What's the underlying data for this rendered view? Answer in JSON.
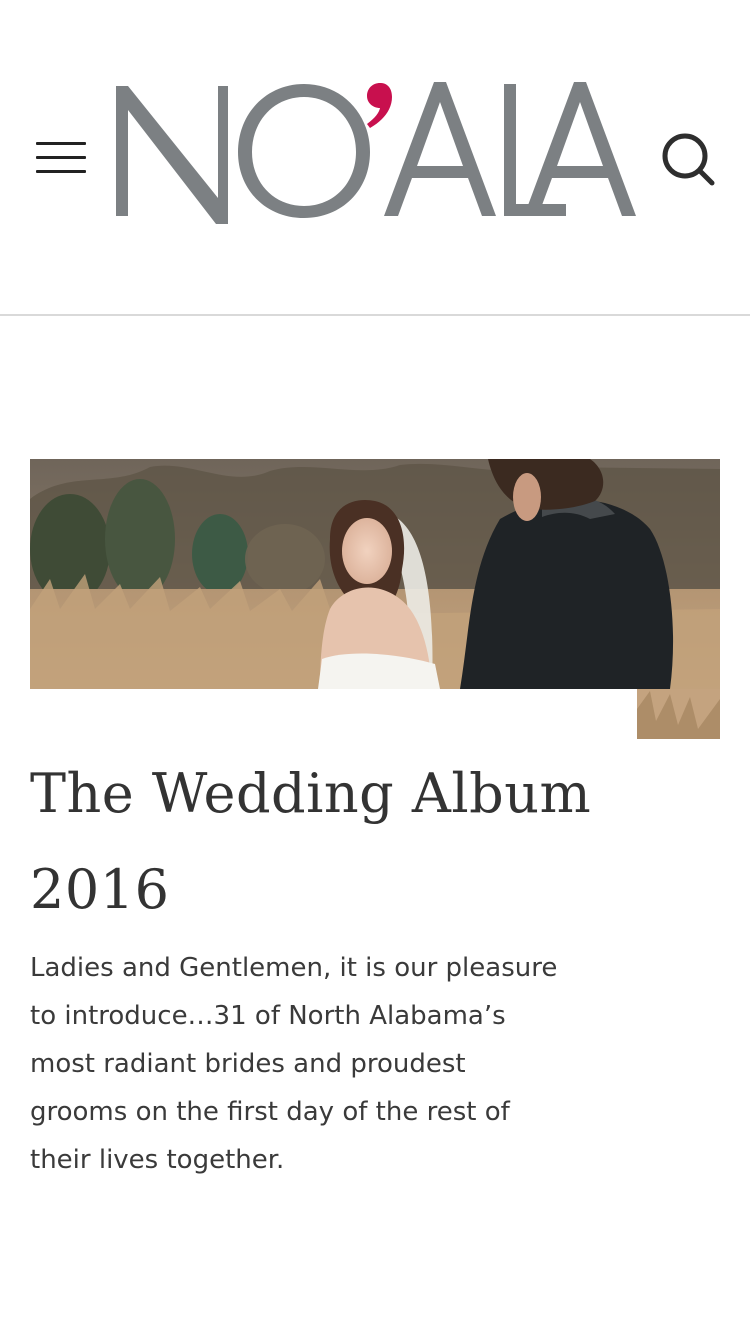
{
  "header": {
    "menu_icon": "hamburger-menu-icon",
    "logo_text": "NO'ALA",
    "logo_colors": {
      "text": "#7c8083",
      "apostrophe": "#c8104e"
    },
    "search_icon": "search-icon"
  },
  "article": {
    "image_alt": "Bride in white gown smiling over her shoulder at groom in a dark tuxedo in a meadow",
    "title": "The Wedding Album 2016",
    "description": "Ladies and Gentlemen, it is our pleasure to introduce…31 of North Alabama’s most radiant brides and proudest grooms on the first day of the rest of their lives together."
  }
}
